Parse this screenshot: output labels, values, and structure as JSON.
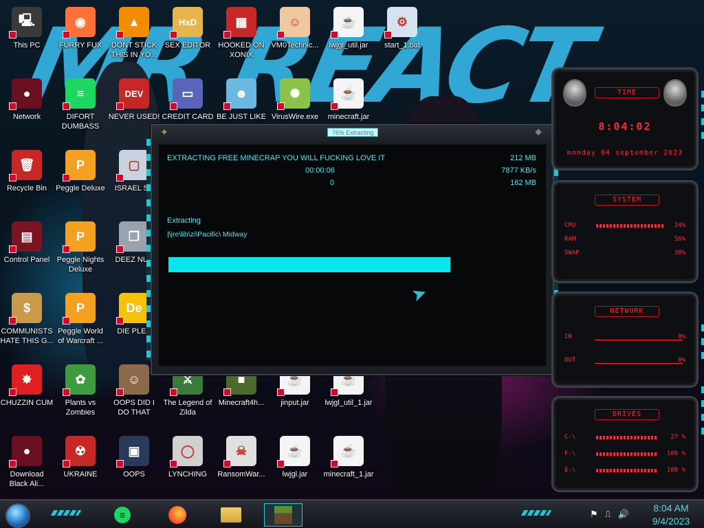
{
  "desktop": {
    "wallpaper_text": "MR REACT",
    "icons": [
      {
        "label": "This PC",
        "icon": "computer-icon",
        "color": "#3a3a3a",
        "glyph": "🖳"
      },
      {
        "label": "FURRY FUX",
        "icon": "firefox-icon",
        "color": "#ff7139",
        "glyph": "◉"
      },
      {
        "label": "DONT STICK THIS IN YO...",
        "icon": "vlc-cone-icon",
        "color": "#f28c00",
        "glyph": "▲"
      },
      {
        "label": "SEX EDITOR",
        "icon": "hxd-editor-icon",
        "color": "#e8b44c",
        "glyph": "HxD"
      },
      {
        "label": "HOOKED ON XONIX",
        "icon": "maze-game-icon",
        "color": "#c62828",
        "glyph": "▦"
      },
      {
        "label": "VM0Technic...",
        "icon": "doctor-icon",
        "color": "#f0c8a0",
        "glyph": "☺"
      },
      {
        "label": "lwjgl_util.jar",
        "icon": "java-jar-icon",
        "color": "#f4f4f4",
        "glyph": "☕"
      },
      {
        "label": "start_1.bat",
        "icon": "batch-gear-icon",
        "color": "#d6e2ee",
        "glyph": "⚙"
      },
      {
        "label": "Network",
        "icon": "network-orb-icon",
        "color": "#6a1020",
        "glyph": "●"
      },
      {
        "label": "DIFORT DUMBASS",
        "icon": "discord-icon",
        "color": "#1ed760",
        "glyph": "≡"
      },
      {
        "label": "NEVER USED!",
        "icon": "dev-cpp-icon",
        "color": "#c62828",
        "glyph": "DEV"
      },
      {
        "label": "CREDIT CARD",
        "icon": "credit-card-icon",
        "color": "#5a64b8",
        "glyph": "▭"
      },
      {
        "label": "BE JUST LIKE",
        "icon": "gnome-icon",
        "color": "#6bb8e0",
        "glyph": "☻"
      },
      {
        "label": "VirusWire.exe",
        "icon": "limewire-icon",
        "color": "#8bc34a",
        "glyph": "✺"
      },
      {
        "label": "minecraft.jar",
        "icon": "java-jar-icon",
        "color": "#f4f4f4",
        "glyph": "☕"
      },
      {
        "label": "Recycle Bin",
        "icon": "recycle-bin-icon",
        "color": "#c62828",
        "glyph": "🗑"
      },
      {
        "label": "Peggle Deluxe",
        "icon": "peggle-icon",
        "color": "#f4a020",
        "glyph": "P"
      },
      {
        "label": "ISRAEL SP",
        "icon": "folder-icon",
        "color": "#c9d3df",
        "glyph": "▢"
      },
      {
        "label": "Control Panel",
        "icon": "control-panel-icon",
        "color": "#7a1420",
        "glyph": "▤"
      },
      {
        "label": "Peggle Nights Deluxe",
        "icon": "peggle-nights-icon",
        "color": "#f4a020",
        "glyph": "P"
      },
      {
        "label": "DEEZ NUT",
        "icon": "stacked-windows-icon",
        "color": "#9aa3ad",
        "glyph": "❐"
      },
      {
        "label": "COMMUNISTS HATE THIS G...",
        "icon": "money-bag-icon",
        "color": "#c89a4a",
        "glyph": "$"
      },
      {
        "label": "Peggle World of Warcraft ...",
        "icon": "peggle-wow-icon",
        "color": "#f4a020",
        "glyph": "P"
      },
      {
        "label": "DIE PLEA",
        "icon": "die-logo-icon",
        "color": "#f4c20d",
        "glyph": "De"
      },
      {
        "label": "CHUZZIN CUM",
        "icon": "chuzzle-icon",
        "color": "#e02020",
        "glyph": "✸"
      },
      {
        "label": "Plants vs Zombies",
        "icon": "plants-vs-zombies-icon",
        "color": "#3f9b3f",
        "glyph": "✿"
      },
      {
        "label": "OOPS DID I DO THAT",
        "icon": "portrait-icon",
        "color": "#8a6a4a",
        "glyph": "☺"
      },
      {
        "label": "The Legend of Zilda",
        "icon": "zelda-icon",
        "color": "#3a7a3a",
        "glyph": "⚔"
      },
      {
        "label": "Minecraft4h...",
        "icon": "minecraft-block-icon",
        "color": "#4b6b2e",
        "glyph": "■"
      },
      {
        "label": "jinput.jar",
        "icon": "java-jar-icon",
        "color": "#f4f4f4",
        "glyph": "☕"
      },
      {
        "label": "lwjgl_util_1.jar",
        "icon": "java-jar-icon",
        "color": "#f4f4f4",
        "glyph": "☕"
      },
      {
        "label": "Download Black Ali...",
        "icon": "alien-orb-icon",
        "color": "#6a1020",
        "glyph": "●"
      },
      {
        "label": "UKRAINE",
        "icon": "radiation-icon",
        "color": "#c62828",
        "glyph": "☢"
      },
      {
        "label": "OOPS",
        "icon": "terminal-icon",
        "color": "#2a3a5a",
        "glyph": "▣"
      },
      {
        "label": "LYNCHING",
        "icon": "noose-icon",
        "color": "#d0d0d0",
        "glyph": "◯"
      },
      {
        "label": "RansomWar...",
        "icon": "skull-icon",
        "color": "#e0e0e0",
        "glyph": "☠"
      },
      {
        "label": "lwjgl.jar",
        "icon": "java-jar-icon",
        "color": "#f4f4f4",
        "glyph": "☕"
      },
      {
        "label": "minecraft_1.jar",
        "icon": "java-jar-icon",
        "color": "#f4f4f4",
        "glyph": "☕"
      }
    ]
  },
  "dialog": {
    "title": "76% Extracting",
    "heading": "EXTRACTING FREE MINECRAP YOU WILL FUCKING LOVE IT",
    "elapsed": "00:00:06",
    "processed": "0",
    "total_size": "212 MB",
    "speed": "7877 KB/s",
    "packed_size": "162 MB",
    "status": "Extracting",
    "current_path": "|\\jre\\lib\\zi\\Pacific\\ Midway",
    "progress": 0.76
  },
  "gadget": {
    "time_header": "TIME",
    "time": "8:04:02",
    "date": "monday 04 september 2023",
    "system_header": "SYSTEM",
    "system_rows": [
      {
        "label": "CPU",
        "value": "24%"
      },
      {
        "label": "RAM",
        "value": "56%"
      },
      {
        "label": "SWAP",
        "value": "38%"
      }
    ],
    "network_header": "NETWORK",
    "network_rows": [
      {
        "label": "IN",
        "value": "0%"
      },
      {
        "label": "OUT",
        "value": "0%"
      }
    ],
    "drives_header": "DRIVES",
    "drive_rows": [
      {
        "label": "C:\\",
        "value": "27 %"
      },
      {
        "label": "F:\\",
        "value": "100 %"
      },
      {
        "label": "E:\\",
        "value": "100 %"
      }
    ],
    "accent": "#ff2a35"
  },
  "taskbar": {
    "apps": [
      {
        "name": "discord",
        "icon": "discord-icon"
      },
      {
        "name": "firefox",
        "icon": "firefox-icon"
      },
      {
        "name": "file-explorer",
        "icon": "folder-icon"
      },
      {
        "name": "minecraft",
        "icon": "minecraft-block-icon",
        "active": true
      }
    ],
    "tray_icons": [
      "flag-icon",
      "network-icon",
      "volume-icon"
    ],
    "time": "8:04 AM",
    "date": "9/4/2023"
  }
}
